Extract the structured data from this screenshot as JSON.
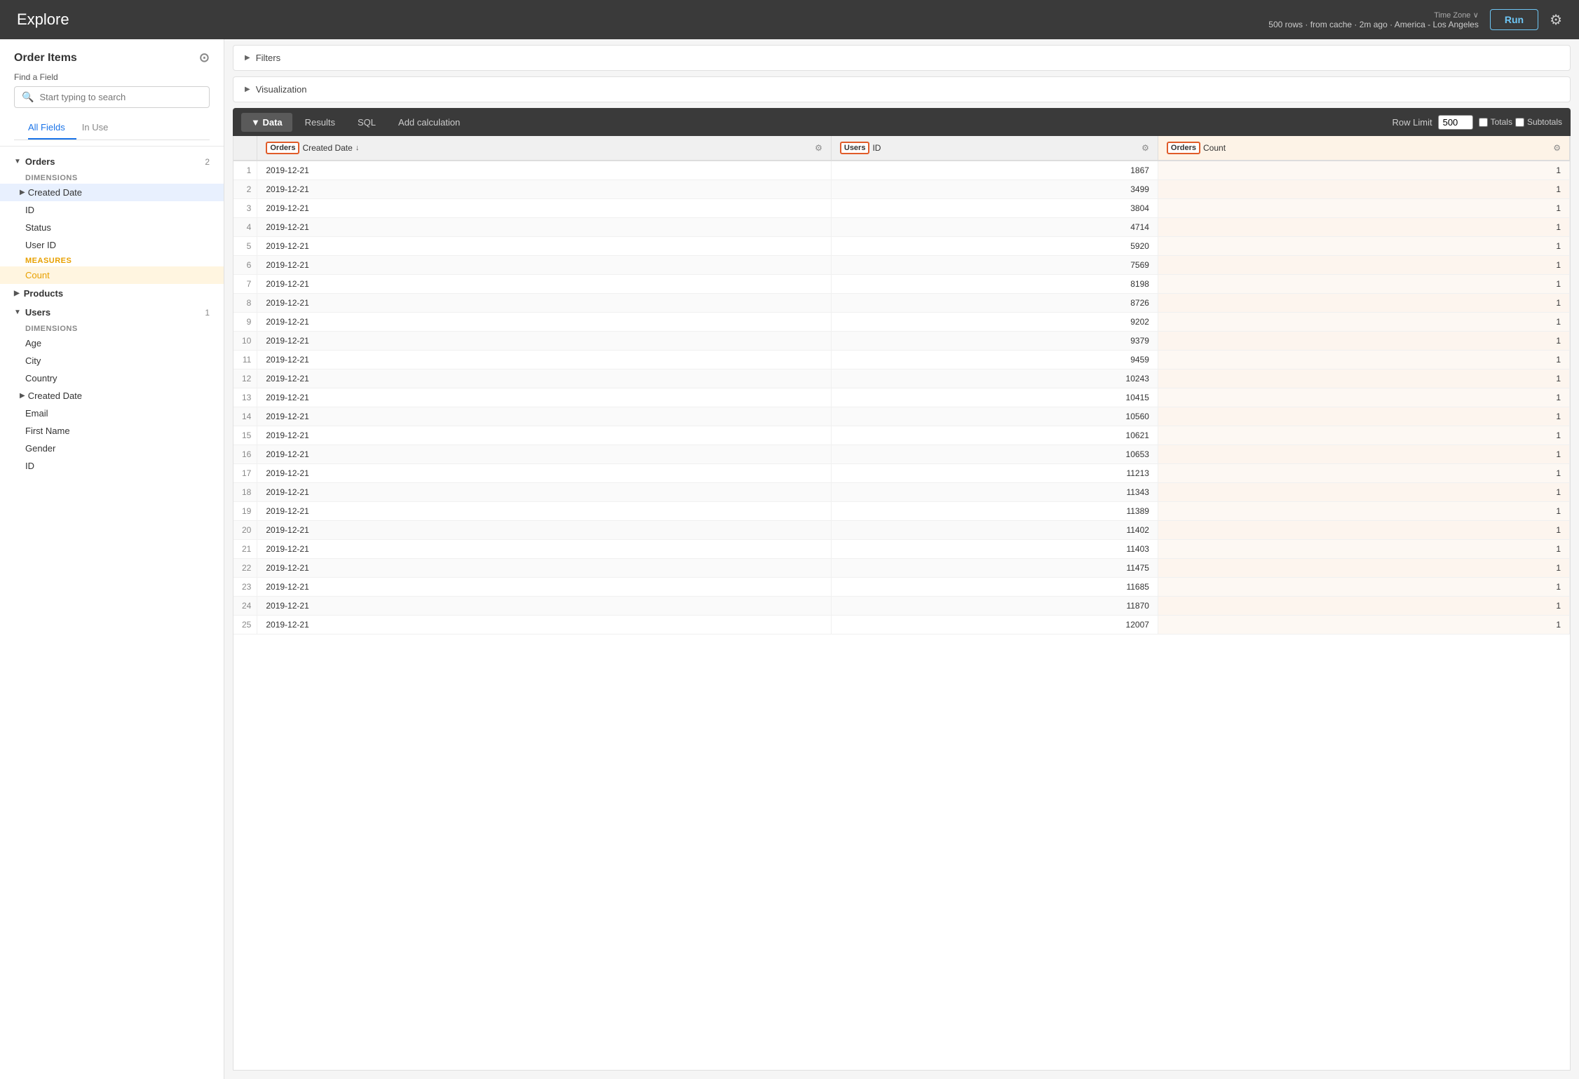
{
  "topbar": {
    "title": "Explore",
    "meta_rows": "500 rows",
    "meta_source": "from cache",
    "meta_time": "2m ago",
    "meta_tz_label": "Time Zone",
    "meta_tz": "America - Los Angeles",
    "run_label": "Run"
  },
  "sidebar": {
    "title": "Order Items",
    "find_field_label": "Find a Field",
    "search_placeholder": "Start typing to search",
    "tabs": [
      {
        "label": "All Fields",
        "active": true
      },
      {
        "label": "In Use",
        "active": false
      }
    ],
    "groups": [
      {
        "name": "Orders",
        "expanded": true,
        "count": 2,
        "sections": [
          {
            "type": "dimensions",
            "label": "DIMENSIONS",
            "fields": [
              {
                "name": "Created Date",
                "has_arrow": true,
                "selected": true
              },
              {
                "name": "ID",
                "has_arrow": false
              },
              {
                "name": "Status",
                "has_arrow": false
              },
              {
                "name": "User ID",
                "has_arrow": false
              }
            ]
          },
          {
            "type": "measures",
            "label": "MEASURES",
            "fields": [
              {
                "name": "Count",
                "selected": true
              }
            ]
          }
        ]
      },
      {
        "name": "Products",
        "expanded": false,
        "count": null,
        "sections": []
      },
      {
        "name": "Users",
        "expanded": true,
        "count": 1,
        "sections": [
          {
            "type": "dimensions",
            "label": "DIMENSIONS",
            "fields": [
              {
                "name": "Age",
                "has_arrow": false
              },
              {
                "name": "City",
                "has_arrow": false
              },
              {
                "name": "Country",
                "has_arrow": false
              },
              {
                "name": "Created Date",
                "has_arrow": true
              },
              {
                "name": "Email",
                "has_arrow": false
              },
              {
                "name": "First Name",
                "has_arrow": false
              },
              {
                "name": "Gender",
                "has_arrow": false
              },
              {
                "name": "ID",
                "has_arrow": false
              }
            ]
          }
        ]
      }
    ]
  },
  "filters_label": "Filters",
  "visualization_label": "Visualization",
  "toolbar": {
    "tabs": [
      {
        "label": "Data",
        "active": true
      },
      {
        "label": "Results",
        "active": false
      },
      {
        "label": "SQL",
        "active": false
      },
      {
        "label": "Add calculation",
        "active": false
      }
    ],
    "row_limit_label": "Row Limit",
    "row_limit_value": "500",
    "totals_label": "Totals",
    "subtotals_label": "Subtotals"
  },
  "table": {
    "columns": [
      {
        "label": "Orders",
        "sublabel": "Created Date",
        "sort": "↓",
        "type": "dimension",
        "group": "Orders"
      },
      {
        "label": "Users",
        "sublabel": "ID",
        "sort": "",
        "type": "dimension",
        "group": "Users"
      },
      {
        "label": "Orders",
        "sublabel": "Count",
        "sort": "",
        "type": "measure",
        "group": "Orders"
      }
    ],
    "rows": [
      [
        1,
        "2019-12-21",
        1867,
        1
      ],
      [
        2,
        "2019-12-21",
        3499,
        1
      ],
      [
        3,
        "2019-12-21",
        3804,
        1
      ],
      [
        4,
        "2019-12-21",
        4714,
        1
      ],
      [
        5,
        "2019-12-21",
        5920,
        1
      ],
      [
        6,
        "2019-12-21",
        7569,
        1
      ],
      [
        7,
        "2019-12-21",
        8198,
        1
      ],
      [
        8,
        "2019-12-21",
        8726,
        1
      ],
      [
        9,
        "2019-12-21",
        9202,
        1
      ],
      [
        10,
        "2019-12-21",
        9379,
        1
      ],
      [
        11,
        "2019-12-21",
        9459,
        1
      ],
      [
        12,
        "2019-12-21",
        10243,
        1
      ],
      [
        13,
        "2019-12-21",
        10415,
        1
      ],
      [
        14,
        "2019-12-21",
        10560,
        1
      ],
      [
        15,
        "2019-12-21",
        10621,
        1
      ],
      [
        16,
        "2019-12-21",
        10653,
        1
      ],
      [
        17,
        "2019-12-21",
        11213,
        1
      ],
      [
        18,
        "2019-12-21",
        11343,
        1
      ],
      [
        19,
        "2019-12-21",
        11389,
        1
      ],
      [
        20,
        "2019-12-21",
        11402,
        1
      ],
      [
        21,
        "2019-12-21",
        11403,
        1
      ],
      [
        22,
        "2019-12-21",
        11475,
        1
      ],
      [
        23,
        "2019-12-21",
        11685,
        1
      ],
      [
        24,
        "2019-12-21",
        11870,
        1
      ],
      [
        25,
        "2019-12-21",
        12007,
        1
      ]
    ]
  }
}
